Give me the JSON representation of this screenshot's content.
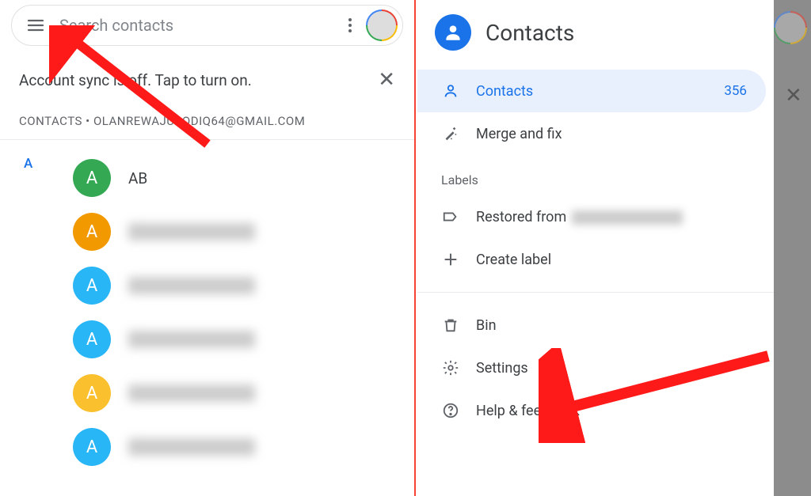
{
  "search": {
    "placeholder": "Search contacts"
  },
  "sync_banner": {
    "text": "Account sync is off. Tap to turn on."
  },
  "account_line": "CONTACTS • OLANREWAJUSODIQ64@GMAIL.COM",
  "group_letter": "A",
  "contacts": [
    {
      "initial": "A",
      "name": "AB",
      "color": "#34a853"
    },
    {
      "initial": "A",
      "name": "",
      "color": "#f29900"
    },
    {
      "initial": "A",
      "name": "",
      "color": "#29b6f6"
    },
    {
      "initial": "A",
      "name": "",
      "color": "#29b6f6"
    },
    {
      "initial": "A",
      "name": "",
      "color": "#fbc02d"
    },
    {
      "initial": "A",
      "name": "",
      "color": "#29b6f6"
    }
  ],
  "drawer": {
    "title": "Contacts",
    "items": {
      "contacts": {
        "label": "Contacts",
        "count": "356"
      },
      "merge": {
        "label": "Merge and fix"
      }
    },
    "labels_heading": "Labels",
    "label_row_prefix": "Restored from",
    "create_label": "Create label",
    "bin": "Bin",
    "settings": "Settings",
    "help": "Help & feedback"
  }
}
